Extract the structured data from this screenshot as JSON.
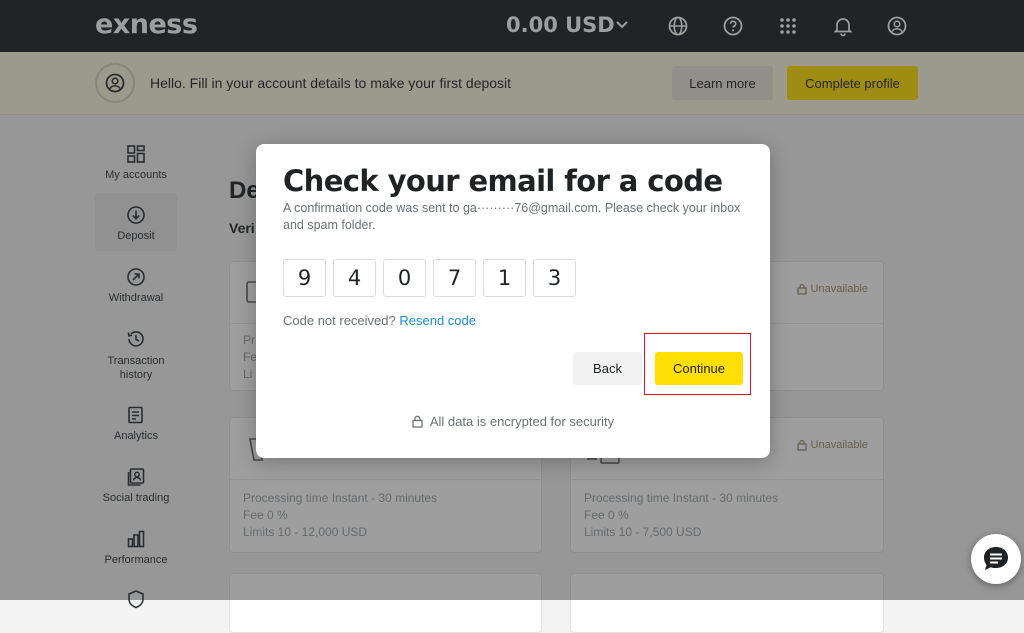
{
  "topbar": {
    "logo": "exness",
    "balance": "0.00 USD",
    "icons": [
      "globe-icon",
      "help-icon",
      "apps-grid-icon",
      "bell-icon",
      "profile-icon"
    ]
  },
  "banner": {
    "text": "Hello. Fill in your account details to make your first deposit",
    "learn_more": "Learn more",
    "complete_profile": "Complete profile"
  },
  "sidebar": {
    "items": [
      {
        "label": "My accounts",
        "icon": "dashboard-icon"
      },
      {
        "label": "Deposit",
        "icon": "deposit-icon"
      },
      {
        "label": "Withdrawal",
        "icon": "withdrawal-icon"
      },
      {
        "label": "Transaction history",
        "icon": "history-icon"
      },
      {
        "label": "Analytics",
        "icon": "analytics-icon"
      },
      {
        "label": "Social trading",
        "icon": "social-trading-icon"
      },
      {
        "label": "Performance",
        "icon": "performance-icon"
      }
    ]
  },
  "page": {
    "title_partial": "De",
    "subtitle_partial": "Veri",
    "cards": [
      {
        "status": "",
        "processing_partial": "Pr",
        "fee_partial": "Fe",
        "limits_partial": "Li"
      },
      {
        "status": "Unavailable"
      },
      {
        "status": "",
        "processing": "Processing time  Instant - 30 minutes",
        "fee": "Fee  0 %",
        "limits": "Limits  10 - 12,000 USD"
      },
      {
        "status": "Unavailable",
        "processing": "Processing time  Instant - 30 minutes",
        "fee": "Fee  0 %",
        "limits": "Limits  10 - 7,500 USD"
      }
    ]
  },
  "modal": {
    "title": "Check your email for a code",
    "description": "A confirmation code was sent to ga·········76@gmail.com. Please check your inbox and spam folder.",
    "code_digits": [
      "9",
      "4",
      "0",
      "7",
      "1",
      "3"
    ],
    "not_received": "Code not received?",
    "resend": "Resend code",
    "back": "Back",
    "continue": "Continue",
    "security_note": "All data is encrypted for security"
  },
  "colors": {
    "brand_yellow": "#ffde02",
    "topbar": "#1c2226",
    "link": "#1a8cd8",
    "highlight": "#e0121e"
  }
}
